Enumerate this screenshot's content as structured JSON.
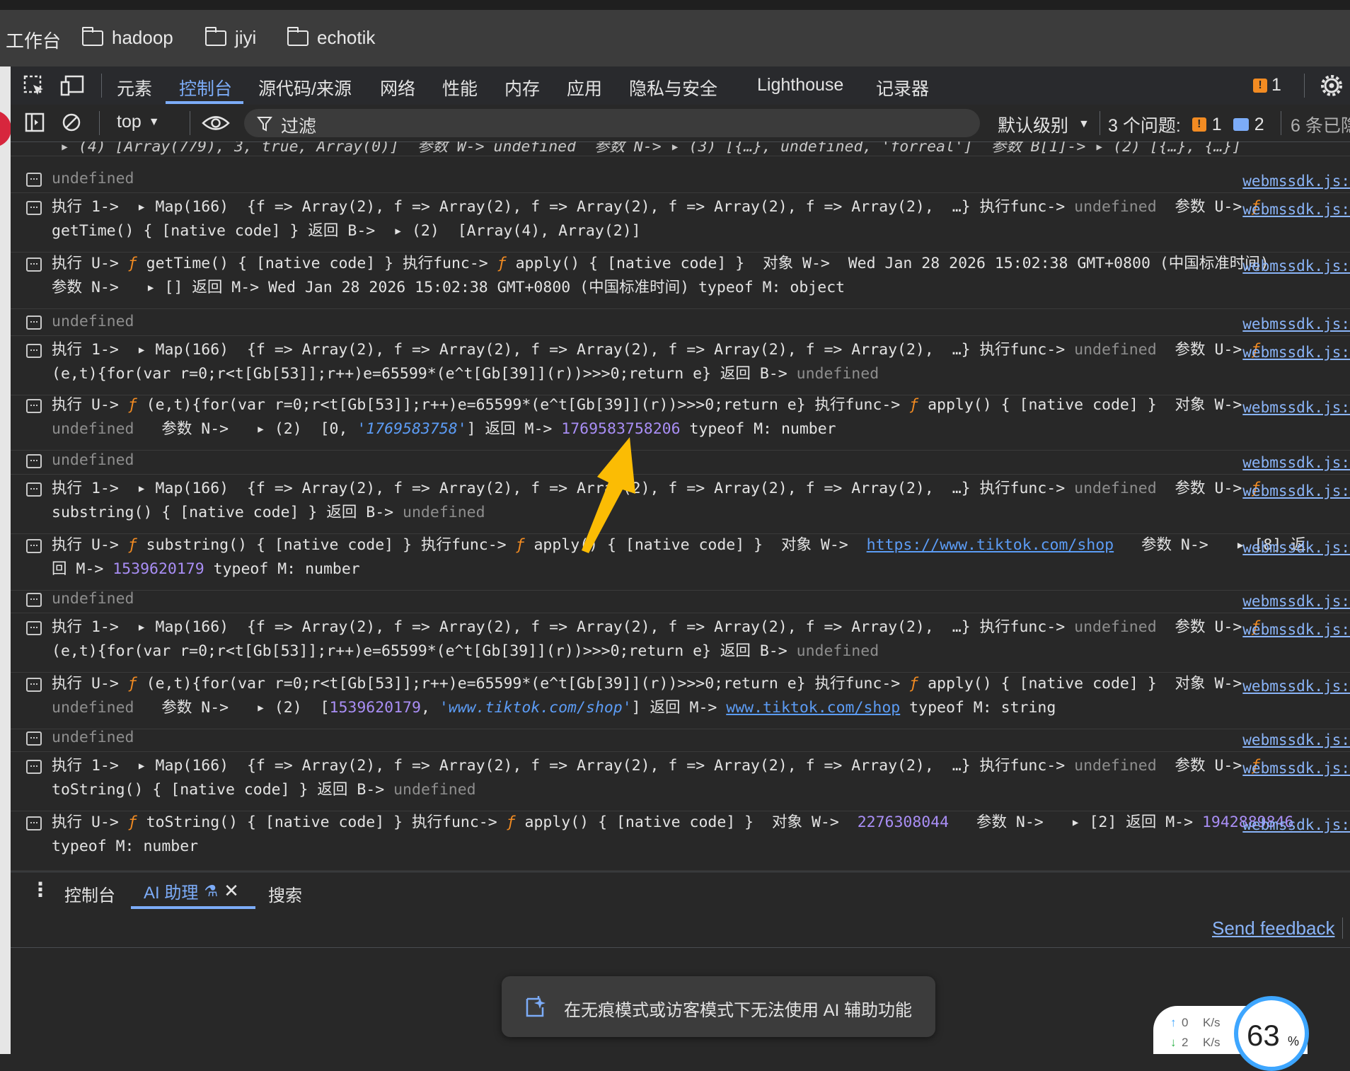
{
  "bookmarks": {
    "first_label": "工作台",
    "items": [
      {
        "label": "hadoop"
      },
      {
        "label": "jiyi"
      },
      {
        "label": "echotik"
      }
    ]
  },
  "devtools_tabs": {
    "items": [
      "元素",
      "控制台",
      "源代码/来源",
      "网络",
      "性能",
      "内存",
      "应用",
      "隐私与安全",
      "Lighthouse",
      "记录器"
    ],
    "active": "控制台",
    "issue_count": "1"
  },
  "console_toolbar": {
    "context": "top",
    "filter_label": "过滤",
    "level": "默认级别",
    "issues_label": "3 个问题:",
    "issues_errors": "1",
    "issues_info": "2",
    "hidden": "6 条已隐"
  },
  "source_link": "webmssdk.js:",
  "console": {
    "partial_top": "▸ (4) [Array(779), 3, true, Array(0)]  参数 W-> undefined  参数 N-> ▸ (3) [{…}, undefined, 'forreal']  参数 B[1]-> ▸ (2) [{…}, {…}]",
    "rows": [
      {
        "l1": "undefined",
        "l2": ""
      },
      {
        "l1": "执行 1->  ▸ Map(166)  {f => Array(2), f => Array(2), f => Array(2), f => Array(2), f => Array(2),  …} 执行func-> undefined  参数 U-> ƒ",
        "l2": "getTime() { [native code] } 返回 B->  ▸ (2)  [Array(4), Array(2)]"
      },
      {
        "l1": "执行 U-> ƒ getTime() { [native code] } 执行func-> ƒ apply() { [native code] }  对象 W->  Wed Jan 28 2026 15:02:38 GMT+0800 (中国标准时间)",
        "l2": "参数 N->   ▸ [] 返回 M-> Wed Jan 28 2026 15:02:38 GMT+0800 (中国标准时间) typeof M: object"
      },
      {
        "l1": "undefined",
        "l2": ""
      },
      {
        "l1": "执行 1->  ▸ Map(166)  {f => Array(2), f => Array(2), f => Array(2), f => Array(2), f => Array(2),  …} 执行func-> undefined  参数 U-> ƒ",
        "l2": "(e,t){for(var r=0;r<t[Gb[53]];r++)e=65599*(e^t[Gb[39]](r))>>>0;return e} 返回 B-> undefined"
      },
      {
        "l1": "执行 U-> ƒ (e,t){for(var r=0;r<t[Gb[53]];r++)e=65599*(e^t[Gb[39]](r))>>>0;return e} 执行func-> ƒ apply() { [native code] }  对象 W->",
        "l2": "undefined   参数 N->   ▸ (2)  [0, '1769583758'] 返回 M-> 1769583758206 typeof M: number"
      },
      {
        "l1": "undefined",
        "l2": ""
      },
      {
        "l1": "执行 1->  ▸ Map(166)  {f => Array(2), f => Array(2), f => Array(2), f => Array(2), f => Array(2),  …} 执行func-> undefined  参数 U-> ƒ",
        "l2": "substring() { [native code] } 返回 B-> undefined"
      },
      {
        "l1": "执行 U-> ƒ substring() { [native code] } 执行func-> ƒ apply() { [native code] }  对象 W->  https://www.tiktok.com/shop   参数 N->   ▸ [8] 返",
        "l2": "回 M-> 1539620179 typeof M: number"
      },
      {
        "l1": "undefined",
        "l2": ""
      },
      {
        "l1": "执行 1->  ▸ Map(166)  {f => Array(2), f => Array(2), f => Array(2), f => Array(2), f => Array(2),  …} 执行func-> undefined  参数 U-> ƒ",
        "l2": "(e,t){for(var r=0;r<t[Gb[53]];r++)e=65599*(e^t[Gb[39]](r))>>>0;return e} 返回 B-> undefined"
      },
      {
        "l1": "执行 U-> ƒ (e,t){for(var r=0;r<t[Gb[53]];r++)e=65599*(e^t[Gb[39]](r))>>>0;return e} 执行func-> ƒ apply() { [native code] }  对象 W->",
        "l2": "undefined   参数 N->   ▸ (2)  [1539620179, 'www.tiktok.com/shop'] 返回 M-> www.tiktok.com/shop typeof M: string"
      },
      {
        "l1": "undefined",
        "l2": ""
      },
      {
        "l1": "执行 1->  ▸ Map(166)  {f => Array(2), f => Array(2), f => Array(2), f => Array(2), f => Array(2),  …} 执行func-> undefined  参数 U-> ƒ",
        "l2": "toString() { [native code] } 返回 B-> undefined"
      },
      {
        "l1": "执行 U-> ƒ toString() { [native code] } 执行func-> ƒ apply() { [native code] }  对象 W->  2276308044   参数 N->   ▸ [2] 返回 M-> 1942889846",
        "l2": "typeof M: number"
      }
    ]
  },
  "drawer": {
    "tabs": [
      "控制台",
      "AI 助理",
      "搜索"
    ],
    "active": "AI 助理",
    "feedback": "Send feedback",
    "toast": "在无痕模式或访客模式下无法使用 AI 辅助功能"
  },
  "netspeed": {
    "up": "0",
    "down": "2",
    "unit": "K/s",
    "percent": "63",
    "percent_sign": "%"
  },
  "colors": {
    "accent": "#7cacf8",
    "link": "#8ab4f8",
    "number": "#a98ef5",
    "string": "#5c9cf5",
    "func": "#f28b22",
    "muted": "#8e8e8e",
    "arrow": "#fbbc04"
  }
}
